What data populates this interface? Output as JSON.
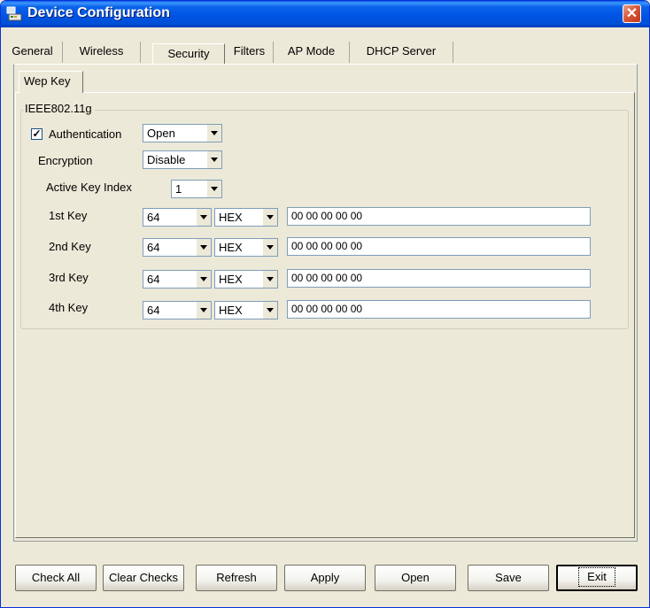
{
  "window": {
    "title": "Device Configuration"
  },
  "tabs": [
    {
      "label": "General"
    },
    {
      "label": "Wireless"
    },
    {
      "label": "Security"
    },
    {
      "label": "Filters"
    },
    {
      "label": "AP Mode"
    },
    {
      "label": "DHCP Server"
    }
  ],
  "subtab": {
    "label": "Wep Key"
  },
  "group": {
    "label": "IEEE802.11g",
    "authentication": {
      "label": "Authentication",
      "checked": true,
      "check_mark": "✓",
      "value": "Open"
    },
    "encryption": {
      "label": "Encryption",
      "value": "Disable"
    },
    "active_key_index": {
      "label": "Active Key Index",
      "value": "1"
    },
    "keys": [
      {
        "label": "1st Key",
        "length": "64",
        "format": "HEX",
        "value": "00 00 00 00 00"
      },
      {
        "label": "2nd Key",
        "length": "64",
        "format": "HEX",
        "value": "00 00 00 00 00"
      },
      {
        "label": "3rd Key",
        "length": "64",
        "format": "HEX",
        "value": "00 00 00 00 00"
      },
      {
        "label": "4th Key",
        "length": "64",
        "format": "HEX",
        "value": "00 00 00 00 00"
      }
    ]
  },
  "buttons": {
    "check_all": "Check All",
    "clear_checks": "Clear Checks",
    "refresh": "Refresh",
    "apply": "Apply",
    "open": "Open",
    "save": "Save",
    "exit": "Exit"
  },
  "icons": {
    "app": "network-device-icon",
    "close": "close-icon",
    "dropdown": "chevron-down-icon"
  },
  "colors": {
    "titlebar": "#0054e3",
    "close": "#d9583a",
    "face": "#ece9d8"
  }
}
